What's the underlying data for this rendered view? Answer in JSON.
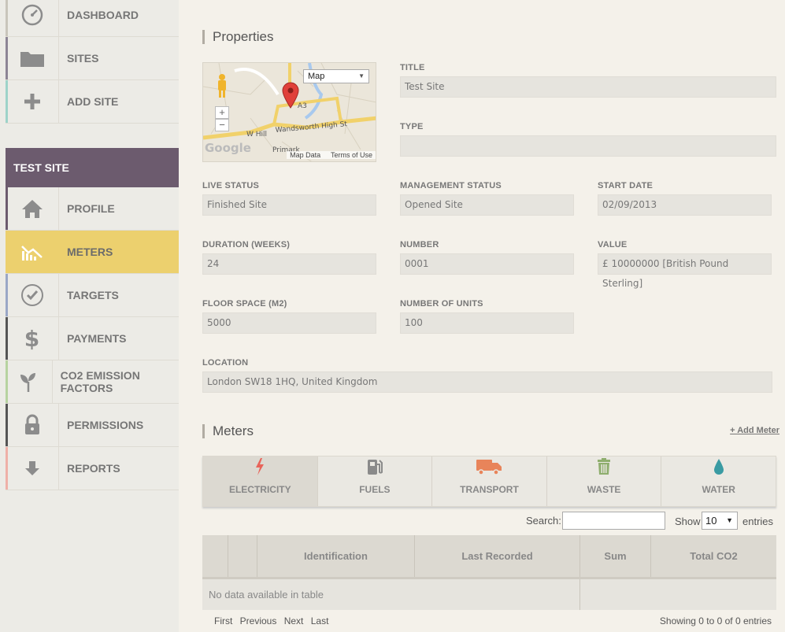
{
  "sidebar": {
    "nav": [
      {
        "label": "DASHBOARD",
        "icon": "dashboard-icon"
      },
      {
        "label": "SITES",
        "icon": "folder-icon"
      },
      {
        "label": "ADD SITE",
        "icon": "plus-icon"
      }
    ],
    "site_title": "TEST SITE",
    "site_nav": [
      {
        "label": "PROFILE",
        "icon": "home-icon"
      },
      {
        "label": "METERS",
        "icon": "meters-icon"
      },
      {
        "label": "TARGETS",
        "icon": "check-icon"
      },
      {
        "label": "PAYMENTS",
        "icon": "dollar-icon"
      },
      {
        "label": "CO2 EMISSION FACTORS",
        "icon": "plant-icon"
      },
      {
        "label": "PERMISSIONS",
        "icon": "lock-icon"
      },
      {
        "label": "REPORTS",
        "icon": "download-icon"
      }
    ],
    "colors": {
      "active": "#ecd06e",
      "site_header": "#6c5b6e"
    }
  },
  "properties": {
    "title": "Properties",
    "map": {
      "type_select": "Map",
      "roads": [
        "A3",
        "W Hill",
        "Wandsworth High St",
        "Primark"
      ],
      "footer_data": "Map Data",
      "footer_terms": "Terms of Use",
      "logo": "Google"
    },
    "fields": {
      "title": {
        "label": "TITLE",
        "value": "Test Site"
      },
      "type": {
        "label": "TYPE",
        "value": ""
      },
      "live_status": {
        "label": "LIVE STATUS",
        "value": "Finished Site"
      },
      "management_status": {
        "label": "MANAGEMENT STATUS",
        "value": "Opened Site"
      },
      "start_date": {
        "label": "START DATE",
        "value": "02/09/2013"
      },
      "duration": {
        "label": "DURATION (WEEKS)",
        "value": "24"
      },
      "number": {
        "label": "NUMBER",
        "value": "0001"
      },
      "value": {
        "label": "VALUE",
        "value": "£ 10000000 [British Pound Sterling]"
      },
      "floor_space": {
        "label": "FLOOR SPACE (M2)",
        "value": "5000"
      },
      "units": {
        "label": "NUMBER OF UNITS",
        "value": "100"
      },
      "location": {
        "label": "LOCATION",
        "value": "London SW18 1HQ, United Kingdom"
      }
    }
  },
  "meters": {
    "title": "Meters",
    "add_link": "+ Add Meter",
    "tabs": [
      {
        "label": "ELECTRICITY",
        "icon": "lightning-icon",
        "color": "#e8645a"
      },
      {
        "label": "FUELS",
        "icon": "fuel-pump-icon",
        "color": "#8a8a8a"
      },
      {
        "label": "TRANSPORT",
        "icon": "truck-icon",
        "color": "#e8845a"
      },
      {
        "label": "WASTE",
        "icon": "trash-icon",
        "color": "#8fae6e"
      },
      {
        "label": "WATER",
        "icon": "droplet-icon",
        "color": "#3a9ba3"
      }
    ],
    "search_label": "Search:",
    "search_value": "",
    "show_label": "Show",
    "show_value": "10",
    "entries_label": "entries",
    "columns": [
      "",
      "",
      "Identification",
      "Last Recorded",
      "Sum",
      "Total CO2"
    ],
    "empty_text": "No data available in table",
    "pager": {
      "first": "First",
      "previous": "Previous",
      "next": "Next",
      "last": "Last"
    },
    "info": "Showing 0 to 0 of 0 entries"
  }
}
